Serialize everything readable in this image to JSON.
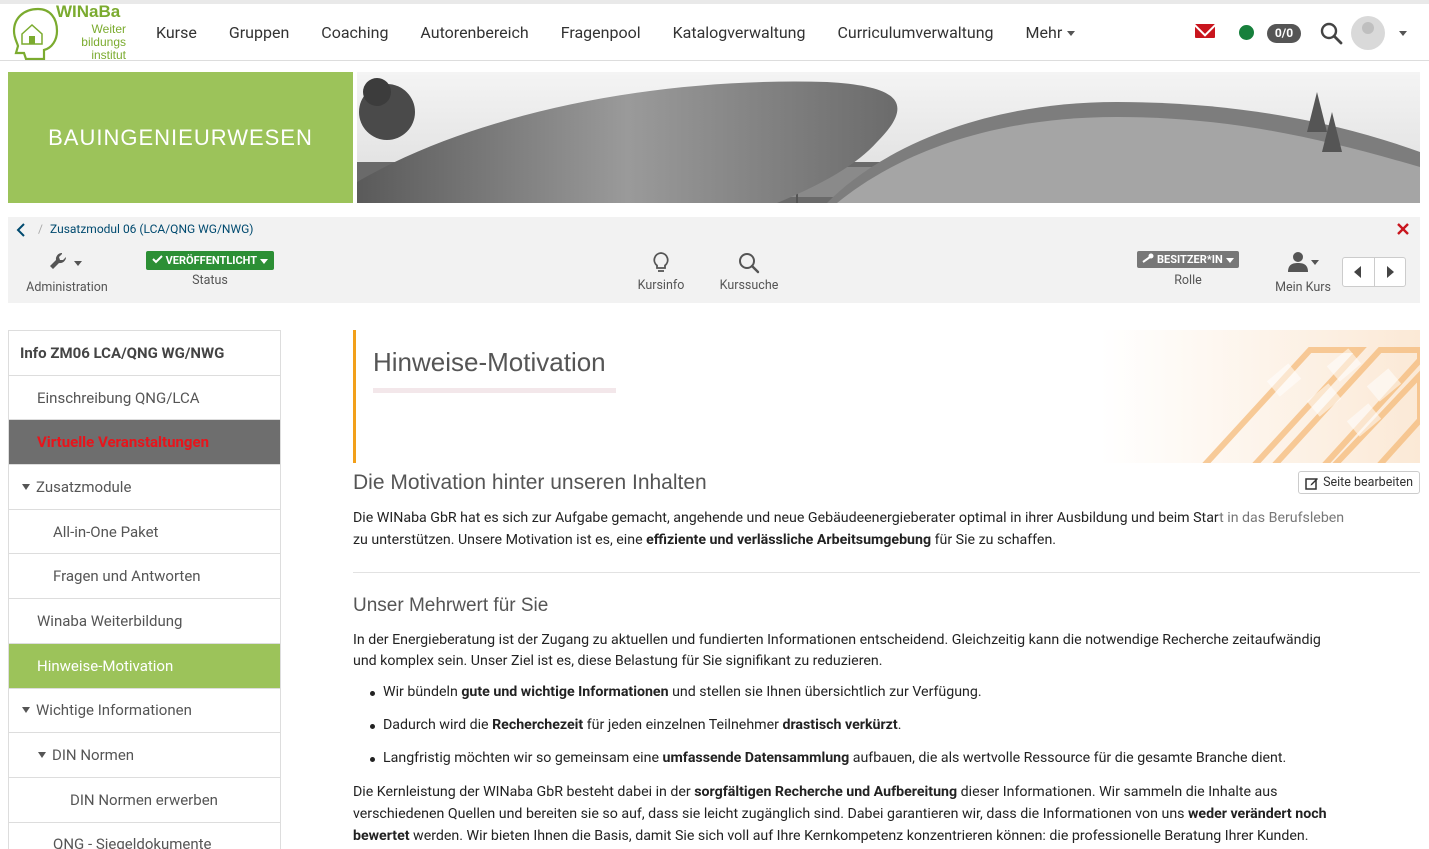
{
  "brand": {
    "title": "WINaBa",
    "sub1": "Weiter",
    "sub2": "bildungs",
    "sub3": "institut",
    "color": "#7bab2f"
  },
  "nav": {
    "items": [
      "Kurse",
      "Gruppen",
      "Coaching",
      "Autorenbereich",
      "Fragenpool",
      "Katalogverwaltung",
      "Curriculumverwaltung"
    ],
    "more": "Mehr",
    "counter": "0/0"
  },
  "banner": {
    "title": "BAUINGENIEURWESEN",
    "color": "#9cc35a"
  },
  "breadcrumb": {
    "course": "Zusatzmodul 06 (LCA/QNG WG/NWG)"
  },
  "toolbar": {
    "admin": "Administration",
    "status_badge": "VERÖFFENTLICHT",
    "status": "Status",
    "kursinfo": "Kursinfo",
    "kurssuche": "Kurssuche",
    "role_badge": "BESITZER*IN",
    "role": "Rolle",
    "mein_kurs": "Mein Kurs"
  },
  "sidebar": {
    "head": "Info ZM06 LCA/QNG WG/NWG",
    "items": [
      "Einschreibung QNG/LCA",
      "Virtuelle Veranstaltungen",
      "Zusatzmodule",
      "All-in-One Paket",
      "Fragen und Antworten",
      "Winaba Weiterbildung",
      "Hinweise-Motivation",
      "Wichtige Informationen",
      "DIN Normen",
      "DIN Normen erwerben",
      "QNG - Siegeldokumente"
    ]
  },
  "page": {
    "title": "Hinweise-Motivation",
    "edit": "Seite bearbeiten",
    "h2": "Die Motivation hinter unseren Inhalten",
    "intro_a": "Die WINaba GbR hat es sich zur Aufgabe gemacht, angehende und neue Gebäudeenergieberater optimal in ihrer Ausbildung und beim Star",
    "intro_fade": "t in das Berufsleben",
    "intro_b": "zu unterstützen. Unsere Motivation ist es, eine ",
    "intro_b_bold": "effiziente und verlässliche Arbeitsumgebung",
    "intro_b_end": " für Sie zu schaffen.",
    "h3": "Unser Mehrwert für Sie",
    "p2_a": "In der Energieberatung ist der Zugang zu aktuellen und fundierten Informationen entscheidend. Gleichzeitig kann die notwendige Recherche zeitaufwändig",
    "p2_b": "und komplex sein. Unser Ziel ist es, diese Belastung für Sie signifikant zu reduzieren.",
    "li1_a": "Wir bündeln ",
    "li1_b": "gute und wichtige Informationen",
    "li1_c": " und stellen sie Ihnen übersichtlich zur Verfügung.",
    "li2_a": "Dadurch wird die ",
    "li2_b": "Recherchezeit",
    "li2_c": " für jeden einzelnen Teilnehmer ",
    "li2_d": "drastisch verkürzt",
    "li2_e": ".",
    "li3_a": "Langfristig möchten wir so gemeinsam eine ",
    "li3_b": "umfassende Datensammlung",
    "li3_c": " aufbauen, die als wertvolle Ressource für die gesamte Branche dient.",
    "p3_a": "Die Kernleistung der WINaba GbR besteht dabei in der ",
    "p3_b": "sorgfältigen Recherche und Aufbereitung",
    "p3_c": " dieser Informationen. Wir sammeln die Inhalte aus",
    "p3_d": "verschiedenen Quellen und bereiten sie so auf, dass sie leicht zugänglich sind. Dabei garantieren wir, dass die Informationen von uns ",
    "p3_e": "weder verändert noch",
    "p3_f": "bewertet",
    "p3_g": " werden. Wir bieten Ihnen die Basis, damit Sie sich voll auf Ihre Kernkompetenz konzentrieren können: die professionelle Beratung Ihrer Kunden."
  }
}
